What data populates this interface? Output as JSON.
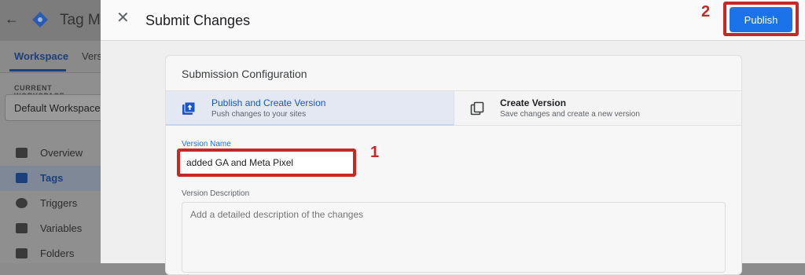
{
  "background_app": {
    "app_name": "Tag Ma",
    "tabs": [
      "Workspace",
      "Vers"
    ],
    "current_workspace_label": "CURRENT WORKSPACE",
    "workspace_name": "Default Workspace",
    "nav_items": [
      {
        "label": "Overview",
        "icon": "overview-icon",
        "active": false
      },
      {
        "label": "Tags",
        "icon": "tag-icon",
        "active": true
      },
      {
        "label": "Triggers",
        "icon": "trigger-icon",
        "active": false
      },
      {
        "label": "Variables",
        "icon": "variables-icon",
        "active": false
      },
      {
        "label": "Folders",
        "icon": "folder-icon",
        "active": false
      }
    ]
  },
  "dialog": {
    "title": "Submit Changes",
    "close_icon": "close-icon",
    "publish_label": "Publish",
    "marker_publish": "2",
    "marker_version_name": "1"
  },
  "config": {
    "title": "Submission Configuration",
    "options": [
      {
        "title": "Publish and Create Version",
        "subtitle": "Push changes to your sites",
        "icon": "publish-upload-icon",
        "selected": true
      },
      {
        "title": "Create Version",
        "subtitle": "Save changes and create a new version",
        "icon": "copy-icon",
        "selected": false
      }
    ]
  },
  "form": {
    "version_name_label": "Version Name",
    "version_name_value": "added GA and Meta Pixel",
    "version_description_label": "Version Description",
    "version_description_placeholder": "Add a detailed description of the changes"
  },
  "colors": {
    "accent": "#1a73e8",
    "highlight": "#c62828"
  }
}
